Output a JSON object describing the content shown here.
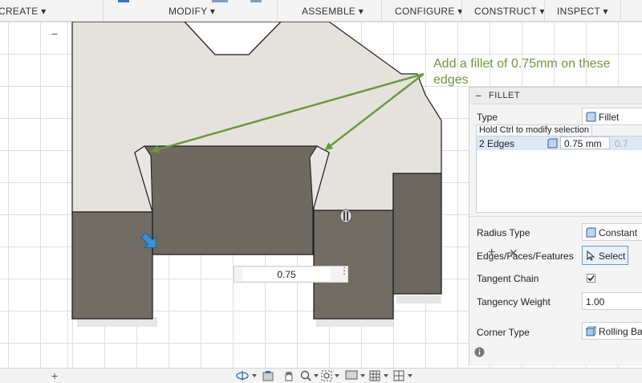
{
  "toolbar": {
    "create": "CREATE ▾",
    "modify": "MODIFY ▾",
    "assemble": "ASSEMBLE ▾",
    "configure": "CONFIGURE ▾",
    "construct": "CONSTRUCT ▾",
    "inspect": "INSPECT ▾"
  },
  "browser": {
    "collapse_glyph": "−"
  },
  "annotation": {
    "text": "Add a fillet of 0.75mm on these edges",
    "color": "#6c9a3f"
  },
  "canvas_dimension": {
    "value": "0.75",
    "menu_glyph": "⋮"
  },
  "fillet_panel": {
    "title": "FILLET",
    "collapse_glyph": "−",
    "type_label": "Type",
    "type_value": "Fillet",
    "tooltip": "Hold Ctrl to modify selection",
    "selection": {
      "label": "2 Edges",
      "radius": "0.75 mm",
      "second_value": "0.7"
    },
    "add_glyph": "+",
    "remove_glyph": "✕",
    "radius_type_label": "Radius Type",
    "radius_type_value": "Constant",
    "edges_label": "Edges/Faces/Features",
    "select_button": "Select",
    "tangent_chain_label": "Tangent Chain",
    "tangent_chain_checked": true,
    "tangency_weight_label": "Tangency Weight",
    "tangency_weight_value": "1.00",
    "corner_type_label": "Corner Type",
    "corner_type_value": "Rolling Ba"
  },
  "bottombar": {
    "add_glyph": "+"
  },
  "colors": {
    "face_light": "#e5e2de",
    "face_dark": "#716c64",
    "accent_blue": "#3a8fd6",
    "annotation_green": "#6c9a3f"
  }
}
